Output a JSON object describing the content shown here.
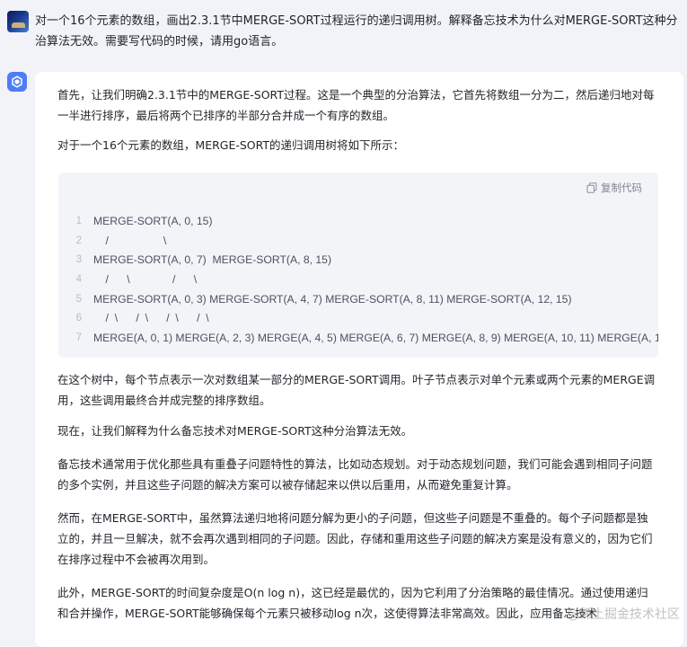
{
  "user": {
    "message": "对一个16个元素的数组，画出2.3.1节中MERGE-SORT过程运行的递归调用树。解释备忘技术为什么对MERGE-SORT这种分治算法无效。需要写代码的时候，请用go语言。"
  },
  "assistant": {
    "paragraphs_top": [
      "首先，让我们明确2.3.1节中的MERGE-SORT过程。这是一个典型的分治算法，它首先将数组一分为二，然后递归地对每一半进行排序，最后将两个已排序的半部分合并成一个有序的数组。",
      "对于一个16个元素的数组，MERGE-SORT的递归调用树将如下所示："
    ],
    "code_block": {
      "copy_label": "复制代码",
      "lines": [
        {
          "no": "1",
          "text": "MERGE-SORT(A, 0, 15)"
        },
        {
          "no": "2",
          "text": "    /                  \\"
        },
        {
          "no": "3",
          "text": "MERGE-SORT(A, 0, 7)  MERGE-SORT(A, 8, 15)"
        },
        {
          "no": "4",
          "text": "    /      \\              /      \\"
        },
        {
          "no": "5",
          "text": "MERGE-SORT(A, 0, 3) MERGE-SORT(A, 4, 7) MERGE-SORT(A, 8, 11) MERGE-SORT(A, 12, 15)"
        },
        {
          "no": "6",
          "text": "    /  \\      /  \\      /  \\      /  \\"
        },
        {
          "no": "7",
          "text": "MERGE(A, 0, 1) MERGE(A, 2, 3) MERGE(A, 4, 5) MERGE(A, 6, 7) MERGE(A, 8, 9) MERGE(A, 10, 11) MERGE(A, 12, 13)"
        }
      ]
    },
    "paragraphs_bottom": [
      "在这个树中，每个节点表示一次对数组某一部分的MERGE-SORT调用。叶子节点表示对单个元素或两个元素的MERGE调用，这些调用最终合并成完整的排序数组。",
      "现在，让我们解释为什么备忘技术对MERGE-SORT这种分治算法无效。",
      "备忘技术通常用于优化那些具有重叠子问题特性的算法，比如动态规划。对于动态规划问题，我们可能会遇到相同子问题的多个实例，并且这些子问题的解决方案可以被存储起来以供以后重用，从而避免重复计算。",
      "然而，在MERGE-SORT中，虽然算法递归地将问题分解为更小的子问题，但这些子问题是不重叠的。每个子问题都是独立的，并且一旦解决，就不会再次遇到相同的子问题。因此，存储和重用这些子问题的解决方案是没有意义的，因为它们在排序过程中不会被再次用到。",
      "此外，MERGE-SORT的时间复杂度是O(n log n)，这已经是最优的，因为它利用了分治策略的最佳情况。通过使用递归和合并操作，MERGE-SORT能够确保每个元素只被移动log n次，这使得算法非常高效。因此，应用备忘技术"
    ]
  },
  "watermark": "@稀土掘金技术社区"
}
